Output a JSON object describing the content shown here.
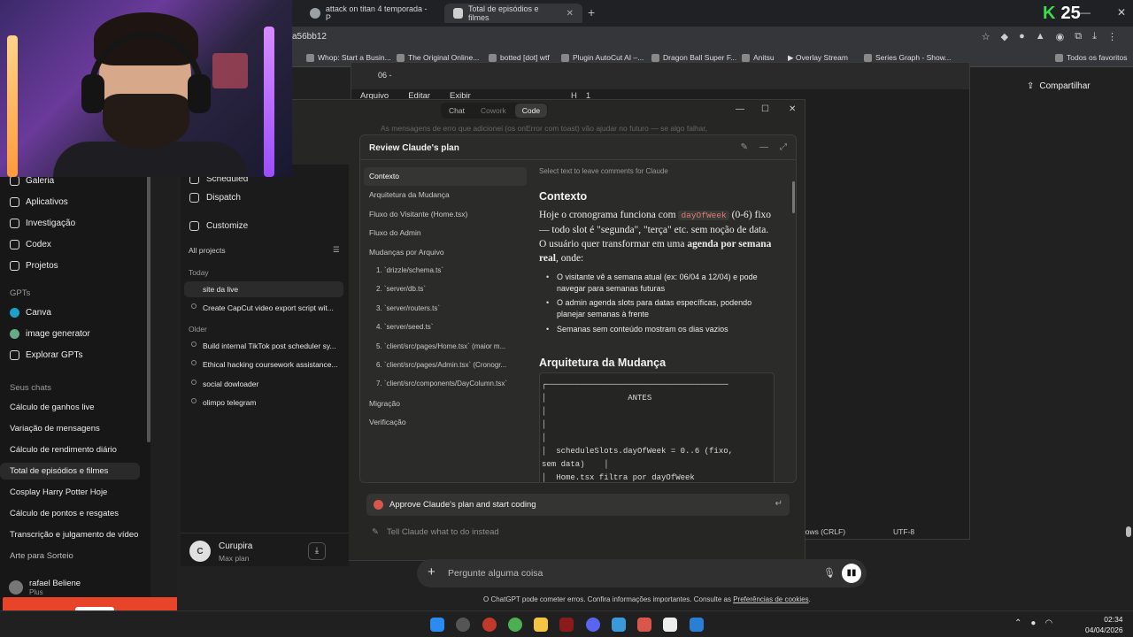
{
  "browser": {
    "tabs": [
      {
        "title": "attack on titan 4 temporada - P"
      },
      {
        "title": "Total de episódios e filmes"
      }
    ],
    "url": "a56bb12",
    "score": "25",
    "bookmarks": [
      "Whop: Start a Busin...",
      "The Original Online...",
      "botted [dot] wtf",
      "Plugin AutoCut AI –...",
      "Dragon Ball Super F...",
      "Anitsu",
      "▶ Overlay Stream",
      "Series Graph - Show..."
    ],
    "all_bookmarks": "Todos os favoritos"
  },
  "gpt_sidebar": {
    "items": [
      "Galeria",
      "Aplicativos",
      "Investigação",
      "Codex",
      "Projetos"
    ],
    "gpts_label": "GPTs",
    "gpts": [
      "Canva",
      "image generator",
      "Explorar GPTs"
    ],
    "chats_label": "Seus chats",
    "chats": [
      "Cálculo de ganhos live",
      "Variação de mensagens",
      "Cálculo de rendimento diário",
      "Total de episódios e filmes",
      "Cosplay Harry Potter Hoje",
      "Cálculo de pontos e resgates",
      "Transcrição e julgamento de vídeo",
      "Arte para Sorteio"
    ],
    "user": {
      "name": "rafael Beliene",
      "plan": "Plus"
    }
  },
  "claude_sidebar": {
    "items": [
      "Scheduled",
      "Dispatch",
      "Customize"
    ],
    "projects": "All projects",
    "today": "Today",
    "today_chats": [
      "site da live",
      "Create CapCut video export script wit..."
    ],
    "older": "Older",
    "older_chats": [
      "Build internal TikTok post scheduler sy...",
      "Ethical hacking coursework assistance...",
      "social dowloader",
      "olimpo telegram"
    ],
    "user": {
      "initial": "C",
      "name": "Curupira",
      "plan": "Max plan"
    }
  },
  "docwin": {
    "tab": "06 -",
    "menu": [
      "Arquivo",
      "Editar",
      "Exibir"
    ],
    "format": "H1",
    "share": "Compartilhar",
    "status": "dows (CRLF)",
    "encoding": "UTF-8"
  },
  "claude": {
    "modes": [
      "Chat",
      "Cowork",
      "Code"
    ],
    "faded_line": "As mensagens de erro que adicionei (os  onError  com toast) vão ajudar no futuro — se algo falhar,",
    "plan_title": "Review Claude's plan",
    "toc": [
      "Contexto",
      "Arquitetura da Mudança",
      "Fluxo do Visitante (Home.tsx)",
      "Fluxo do Admin",
      "Mudanças por Arquivo",
      "1. `drizzle/schema.ts`",
      "2. `server/db.ts`",
      "3. `server/routers.ts`",
      "4. `server/seed.ts`",
      "5. `client/src/pages/Home.tsx` (maior m...",
      "6. `client/src/pages/Admin.tsx` (Cronogr...",
      "7. `client/src/components/DayColumn.tsx`",
      "Migração",
      "Verificação"
    ],
    "hint": "Select text to leave comments for Claude",
    "h_contexto": "Contexto",
    "para": {
      "p1": "Hoje o cronograma funciona com ",
      "code": "dayOfWeek",
      "p2": " (0-6) fixo — todo slot é \"segunda\", \"terça\" etc. sem noção de data. O usuário quer transformar em uma ",
      "bold": "agenda por semana real",
      "p3": ", onde:"
    },
    "bullets": [
      "O visitante vê a semana atual (ex: 06/04 a 12/04) e pode navegar para semanas futuras",
      "O admin agenda slots para datas específicas, podendo planejar semanas à frente",
      "Semanas sem conteúdo mostram os dias vazios"
    ],
    "h_arquitetura": "Arquitetura da Mudança",
    "code_block": "┌──────────────────────────────────────\n│                 ANTES\n│\n│\n│\n│  scheduleSlots.dayOfWeek = 0..6 (fixo,\nsem data)    │\n│  Home.tsx filtra por dayOfWeek",
    "approve": "Approve Claude's plan and start coding",
    "instead": "Tell Claude what to do instead"
  },
  "composer": {
    "placeholder": "Pergunte alguma coisa",
    "disclaimer": "O ChatGPT pode cometer erros. Confira informações importantes. Consulte as ",
    "disclaimer_link": "Preferências de cookies",
    "disclaimer_end": "."
  },
  "taskbar": {
    "time": "02:34",
    "date": "04/04/2026"
  },
  "colors": {
    "accent": "#d8574a",
    "score": "#3ddc4a"
  }
}
